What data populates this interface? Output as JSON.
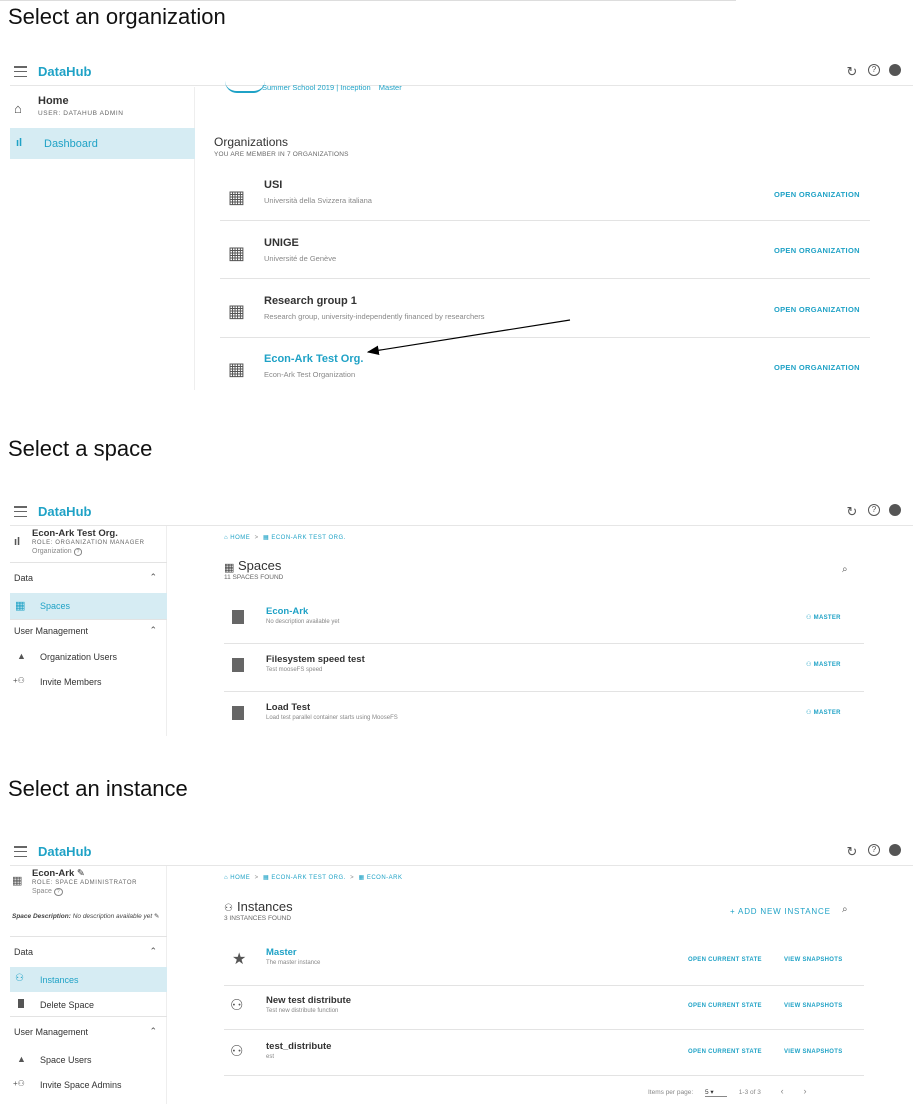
{
  "titles": {
    "org": "Select an organization",
    "space": "Select a space",
    "instance": "Select an instance"
  },
  "app": {
    "brand": "DataHub",
    "icons": [
      "menu-icon",
      "refresh-icon",
      "help-icon",
      "account-icon"
    ]
  },
  "shot1": {
    "home_title": "Home",
    "home_subtitle": "USER: DATAHUB ADMIN",
    "dashboard": "Dashboard",
    "crumbs_partial": [
      "Summer School 2019",
      "Inception",
      "Master"
    ],
    "orgs_title": "Organizations",
    "orgs_subtitle": "YOU ARE MEMBER IN 7 ORGANIZATIONS",
    "open_label": "OPEN ORGANIZATION",
    "orgs": [
      {
        "name": "USI",
        "desc": "Università della Svizzera italiana"
      },
      {
        "name": "UNIGE",
        "desc": "Université de Genève"
      },
      {
        "name": "Research group 1",
        "desc": "Research group, university-independently financed by researchers"
      },
      {
        "name": "Econ-Ark Test Org.",
        "desc": "Econ-Ark Test Organization"
      }
    ]
  },
  "shot2": {
    "org_name": "Econ-Ark Test Org.",
    "org_role": "ROLE: ORGANIZATION MANAGER",
    "org_type": "Organization",
    "data_label": "Data",
    "spaces_item": "Spaces",
    "user_mgmt_label": "User Management",
    "org_users": "Organization Users",
    "invite_members": "Invite Members",
    "breadcrumb": [
      "HOME",
      "ECON-ARK TEST ORG."
    ],
    "spaces_title": "Spaces",
    "spaces_count": "11 SPACES FOUND",
    "master_label": "MASTER",
    "spaces": [
      {
        "name": "Econ-Ark",
        "desc": "No description available yet"
      },
      {
        "name": "Filesystem speed test",
        "desc": "Test mooseFS speed"
      },
      {
        "name": "Load Test",
        "desc": "Load test parallel container starts using MooseFS"
      }
    ]
  },
  "shot3": {
    "space_name": "Econ-Ark",
    "space_role": "ROLE: SPACE ADMINISTRATOR",
    "space_type": "Space",
    "space_desc_label": "Space Description:",
    "space_desc_value": "No description available yet",
    "data_label": "Data",
    "instances_item": "Instances",
    "delete_space": "Delete Space",
    "user_mgmt_label": "User Management",
    "space_users": "Space Users",
    "invite_admins": "Invite Space Admins",
    "breadcrumb": [
      "HOME",
      "ECON-ARK TEST ORG.",
      "ECON-ARK"
    ],
    "instances_title": "Instances",
    "instances_count": "3 INSTANCES FOUND",
    "add_instance": "+ ADD NEW INSTANCE",
    "open_state": "OPEN CURRENT STATE",
    "view_snapshots": "VIEW SNAPSHOTS",
    "instances": [
      {
        "name": "Master",
        "desc": "The master instance"
      },
      {
        "name": "New test distribute",
        "desc": "Test new distribute function"
      },
      {
        "name": "test_distribute",
        "desc": "est"
      }
    ],
    "pager_label": "Items per page:",
    "pager_value": "5",
    "pager_range": "1-3 of 3"
  },
  "colors": {
    "accent": "#1fa2c6",
    "active_bg": "#d6ecf3",
    "arrow": "#000000"
  }
}
